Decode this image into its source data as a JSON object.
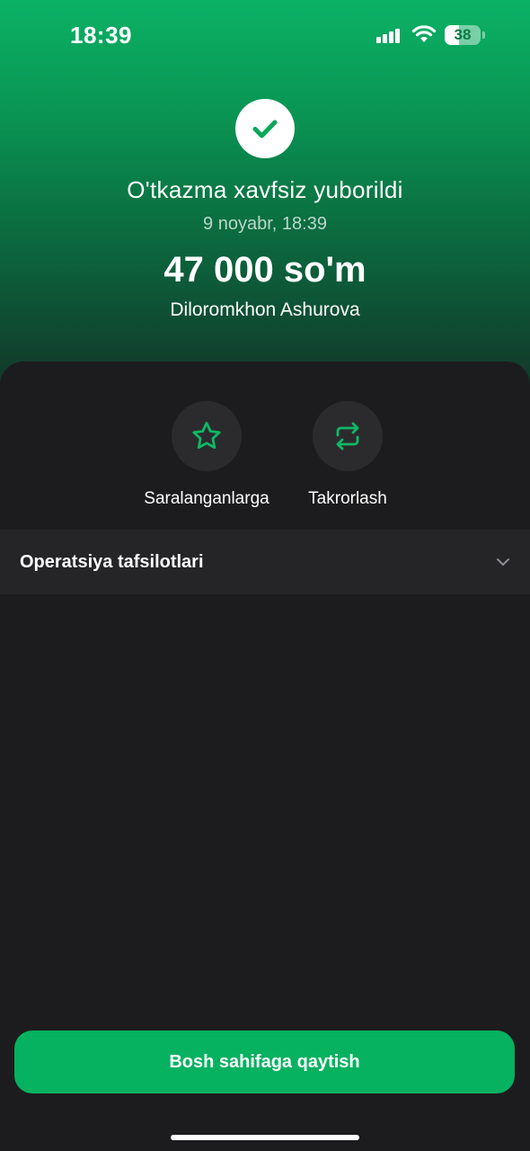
{
  "status_bar": {
    "time": "18:39",
    "battery_level": "38"
  },
  "header": {
    "title": "O'tkazma xavfsiz yuborildi",
    "date": "9 noyabr, 18:39",
    "amount": "47 000 so'm",
    "recipient": "Diloromkhon Ashurova",
    "icon": "check-icon"
  },
  "actions": [
    {
      "label": "Saralanganlarga",
      "icon": "star-icon"
    },
    {
      "label": "Takrorlash",
      "icon": "repeat-icon"
    }
  ],
  "details": {
    "label": "Operatsiya tafsilotlari",
    "icon": "chevron-down-icon"
  },
  "footer": {
    "home_button_label": "Bosh sahifaga qaytish"
  },
  "colors": {
    "accent": "#06b160",
    "background": "#1c1c1e",
    "surface": "#252528"
  }
}
